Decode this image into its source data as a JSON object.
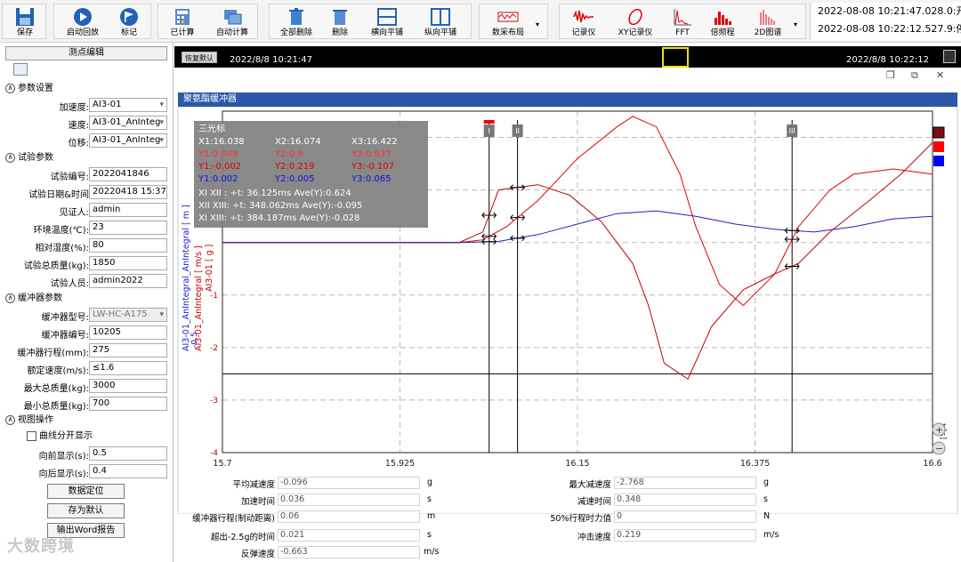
{
  "toolbar": {
    "buttons": [
      {
        "key": "save",
        "label": "保存"
      },
      {
        "key": "start_replay",
        "label": "启动回放"
      },
      {
        "key": "mark",
        "label": "标记"
      },
      {
        "key": "calculated",
        "label": "已计算"
      },
      {
        "key": "auto_calc",
        "label": "自动计算"
      },
      {
        "key": "delete_all",
        "label": "全部删除"
      },
      {
        "key": "delete",
        "label": "删除"
      },
      {
        "key": "h_tile",
        "label": "横向平铺"
      },
      {
        "key": "v_tile",
        "label": "纵向平铺"
      },
      {
        "key": "layout",
        "label": "数采布局"
      },
      {
        "key": "recorder",
        "label": "记录仪"
      },
      {
        "key": "xy_recorder",
        "label": "XY记录仪"
      },
      {
        "key": "fft",
        "label": "FFT"
      },
      {
        "key": "octave",
        "label": "倍频程"
      },
      {
        "key": "2d_spectrum",
        "label": "2D图谱"
      }
    ],
    "time_line1": "2022-08-08 10:21:47.028.0:开始记",
    "time_line2": "2022-08-08 10:22:12.527.9:停止记"
  },
  "left": {
    "header": "测点编辑",
    "sec_param": "参数设置",
    "accel_label": "加速度:",
    "accel_value": "AI3-01",
    "speed_label": "速度:",
    "speed_value": "AI3-01_AnInteg",
    "disp_label": "位移:",
    "disp_value": "AI3-01_AnInteg",
    "sec_test": "试验参数",
    "test_no_label": "试验编号:",
    "test_no": "2022041846",
    "test_date_label": "试验日期&时间",
    "test_date": "20220418 15:37",
    "witness_label": "见证人:",
    "witness": "admin",
    "temp_label": "环境温度(℃):",
    "temp": "23",
    "humid_label": "相对湿度(%):",
    "humid": "80",
    "mass_label": "试验总质量(kg):",
    "mass": "1850",
    "tester_label": "试验人员:",
    "tester": "admin2022",
    "sec_buffer": "缓冲器参数",
    "model_label": "缓冲器型号:",
    "model": "LW-HC-A175",
    "serial_label": "缓冲器编号:",
    "serial": "10205",
    "stroke_label": "缓冲器行程(mm):",
    "stroke": "275",
    "rated_label": "额定速度(m/s):",
    "rated": "≤1.6",
    "maxm_label": "最大总质量(kg):",
    "maxm": "3000",
    "minm_label": "最小总质量(kg):",
    "minm": "700",
    "sec_view": "视图操作",
    "split_label": "曲线分开显示",
    "fwd_label": "向前显示(s):",
    "fwd": "0.5",
    "back_label": "向后显示(s):",
    "back": "0.4",
    "btn_locate": "数据定位",
    "btn_default": "存为默认",
    "btn_word": "输出Word报告"
  },
  "main": {
    "restore_label": "恢复默认",
    "tl_start": "2022/8/8 10:21:47",
    "tl_end": "2022/8/8 10:22:12",
    "window_title": "聚氨酯缓冲器"
  },
  "cursor_info": {
    "title": "三光标",
    "x1": "X1:16.038",
    "x2": "X2:16.074",
    "x3": "X3:16.422",
    "y1r": "Y1:0.049",
    "y2r": "Y2:0.9",
    "y3r": "Y3:0.937",
    "y1m": "Y1:-0.002",
    "y2m": "Y2:0.219",
    "y3m": "Y3:-0.107",
    "y1b": "Y1:0.002",
    "y2b": "Y2:0.005",
    "y3b": "Y3:0.065",
    "d1": "XI  XII : ÷t: 36.125ms Ave(Y):0.624",
    "d2": "XII XIII: ÷t: 348.062ms Ave(Y):-0.095",
    "d3": "XI  XIII: ÷t: 384.187ms Ave(Y):-0.028"
  },
  "chart_data": {
    "type": "line",
    "x_ticks": [
      "15.7",
      "15.925",
      "16.15",
      "16.375",
      "16.6"
    ],
    "xlim": [
      15.7,
      16.6
    ],
    "y_ticks_inner": [
      "1",
      "-1",
      "-2",
      "-3",
      "-4"
    ],
    "y_ticks_outer": [
      "-0.5"
    ],
    "axis_labels": [
      "AI3-01_AnIntegral_AnIntegral [ m ]",
      "AI3-01_AnIntegral [ m/s ]",
      "AI3-01 [ g ]"
    ],
    "x_unit": "t [s]",
    "cursor_labels": [
      "I",
      "II",
      "III"
    ],
    "cursors_x": [
      16.038,
      16.074,
      16.422
    ],
    "series": [
      {
        "color": "#e00000",
        "x": [
          15.7,
          16.0,
          16.03,
          16.06,
          16.1,
          16.15,
          16.2,
          16.22,
          16.25,
          16.28,
          16.3,
          16.33,
          16.36,
          16.4,
          16.43,
          16.47,
          16.5,
          16.55,
          16.6
        ],
        "y": [
          0,
          0,
          0.05,
          0.3,
          0.8,
          1.6,
          2.2,
          2.4,
          2.2,
          1.3,
          0.3,
          -0.8,
          -1.2,
          -0.6,
          0.3,
          1.0,
          1.3,
          1.4,
          1.3
        ]
      },
      {
        "color": "#c00000",
        "x": [
          15.7,
          16.0,
          16.03,
          16.05,
          16.1,
          16.14,
          16.18,
          16.22,
          16.24,
          16.26,
          16.29,
          16.32,
          16.36,
          16.4,
          16.43,
          16.47,
          16.52,
          16.56,
          16.6
        ],
        "y": [
          0,
          0,
          0.2,
          1.0,
          1.1,
          0.9,
          0.4,
          -0.4,
          -1.2,
          -2.3,
          -2.6,
          -1.6,
          -0.9,
          -0.6,
          -0.4,
          0.2,
          0.8,
          1.3,
          1.9
        ]
      },
      {
        "color": "#2020c0",
        "x": [
          15.7,
          16.0,
          16.05,
          16.1,
          16.15,
          16.2,
          16.25,
          16.3,
          16.35,
          16.4,
          16.45,
          16.5,
          16.55,
          16.6
        ],
        "y": [
          0,
          0,
          0.02,
          0.15,
          0.35,
          0.55,
          0.6,
          0.5,
          0.35,
          0.25,
          0.2,
          0.3,
          0.45,
          0.5
        ]
      }
    ]
  },
  "stats": {
    "avg_decel_label": "平均减速度",
    "avg_decel": "-0.096",
    "avg_decel_unit": "g",
    "accel_time_label": "加速时间",
    "accel_time": "0.036",
    "accel_time_unit": "s",
    "stroke_label": "缓冲器行程(制动距离)",
    "stroke": "0.06",
    "stroke_unit": "m",
    "over_label": "超出-2.5g的时间",
    "over": "0.021",
    "over_unit": "s",
    "rebound_label": "反弹速度",
    "rebound": "-0.663",
    "rebound_unit": "m/s",
    "max_decel_label": "最大减速度",
    "max_decel": "-2.768",
    "max_decel_unit": "g",
    "decel_time_label": "减速时间",
    "decel_time": "0.348",
    "decel_time_unit": "s",
    "force50_label": "50%行程时力值",
    "force50": "0",
    "force50_unit": "N",
    "impact_label": "冲击速度",
    "impact": "0.219",
    "impact_unit": "m/s"
  },
  "watermark": "大数跨境"
}
